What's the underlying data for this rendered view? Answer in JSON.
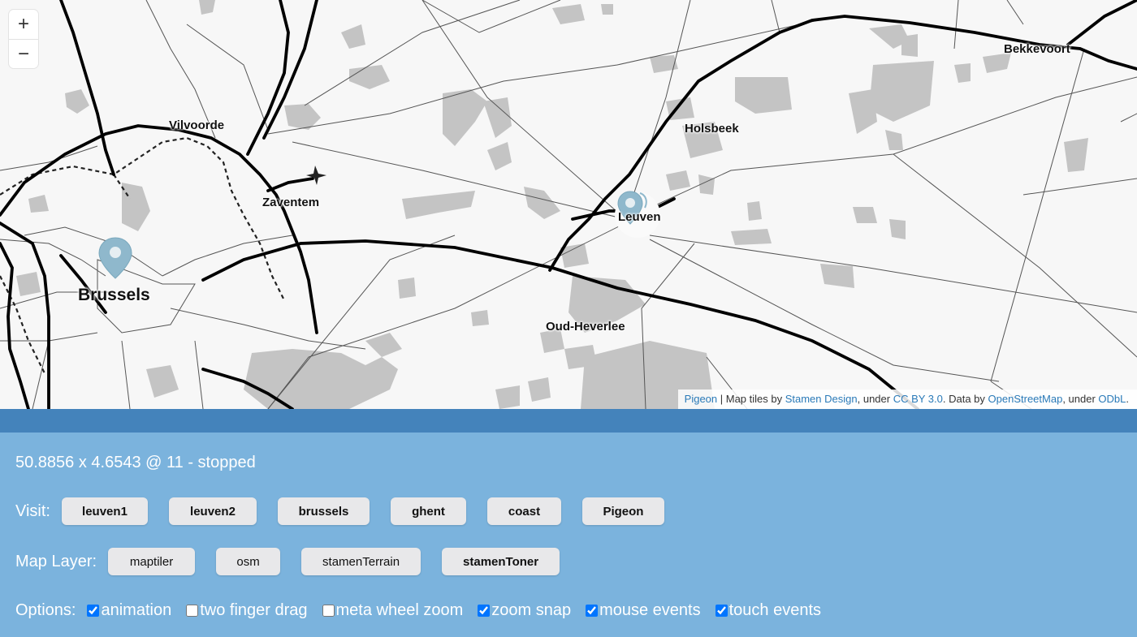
{
  "map": {
    "zoom_in": "+",
    "zoom_out": "−",
    "places": {
      "brussels": "Brussels",
      "vilvoorde": "Vilvoorde",
      "zaventem": "Zaventem",
      "leuven": "Leuven",
      "holsbeek": "Holsbeek",
      "bekkevoort": "Bekkevoort",
      "oud_heverlee": "Oud-Heverlee"
    },
    "attribution": {
      "pigeon": "Pigeon",
      "sep": " | Map tiles by ",
      "stamen": "Stamen Design",
      "under1": ", under ",
      "cc": "CC BY 3.0",
      "data": ". Data by ",
      "osm": "OpenStreetMap",
      "under2": ", under ",
      "odbl": "ODbL",
      "end": "."
    },
    "colors": {
      "marker": "#8fb8cc",
      "road": "#000000",
      "area": "#c4c4c4",
      "link": "#2a7ab8"
    }
  },
  "status_text": "50.8856 x 4.6543 @ 11 - stopped",
  "visit": {
    "label": "Visit:",
    "buttons": [
      "leuven1",
      "leuven2",
      "brussels",
      "ghent",
      "coast",
      "Pigeon"
    ]
  },
  "layer": {
    "label": "Map Layer:",
    "buttons": [
      "maptiler",
      "osm",
      "stamenTerrain",
      "stamenToner"
    ],
    "active": "stamenToner"
  },
  "options": {
    "label": "Options:",
    "items": [
      {
        "label": "animation",
        "checked": true
      },
      {
        "label": "two finger drag",
        "checked": false
      },
      {
        "label": "meta wheel zoom",
        "checked": false
      },
      {
        "label": "zoom snap",
        "checked": true
      },
      {
        "label": "mouse events",
        "checked": true
      },
      {
        "label": "touch events",
        "checked": true
      }
    ]
  }
}
